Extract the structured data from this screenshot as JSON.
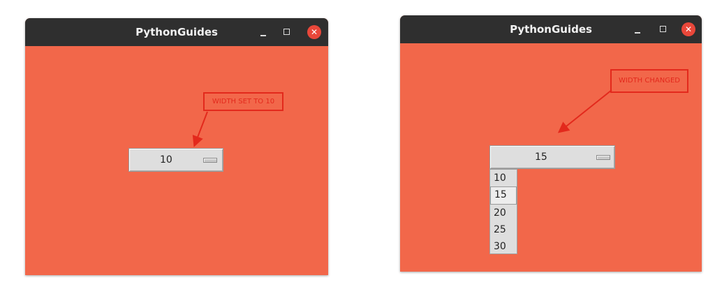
{
  "left_window": {
    "title": "PythonGuides",
    "minimize_glyph": "–",
    "maximize_glyph": "□",
    "close_glyph": "✕",
    "option_menu": {
      "selected": "10"
    },
    "callout": "WIDTH SET TO 10"
  },
  "right_window": {
    "title": "PythonGuides",
    "minimize_glyph": "–",
    "maximize_glyph": "□",
    "close_glyph": "✕",
    "option_menu": {
      "selected": "15"
    },
    "callout": "WIDTH CHANGED",
    "dropdown_options": [
      "10",
      "15",
      "20",
      "25",
      "30"
    ],
    "highlighted_option": "15"
  },
  "colors": {
    "window_bg": "#f2674a",
    "titlebar": "#2f2f2f",
    "close_button": "#e9473a",
    "annotation": "#e3291c",
    "widget_bg": "#dedede"
  },
  "icons": [
    "minimize-icon",
    "maximize-icon",
    "close-icon",
    "dropdown-indicator-icon",
    "arrow-annotation"
  ]
}
